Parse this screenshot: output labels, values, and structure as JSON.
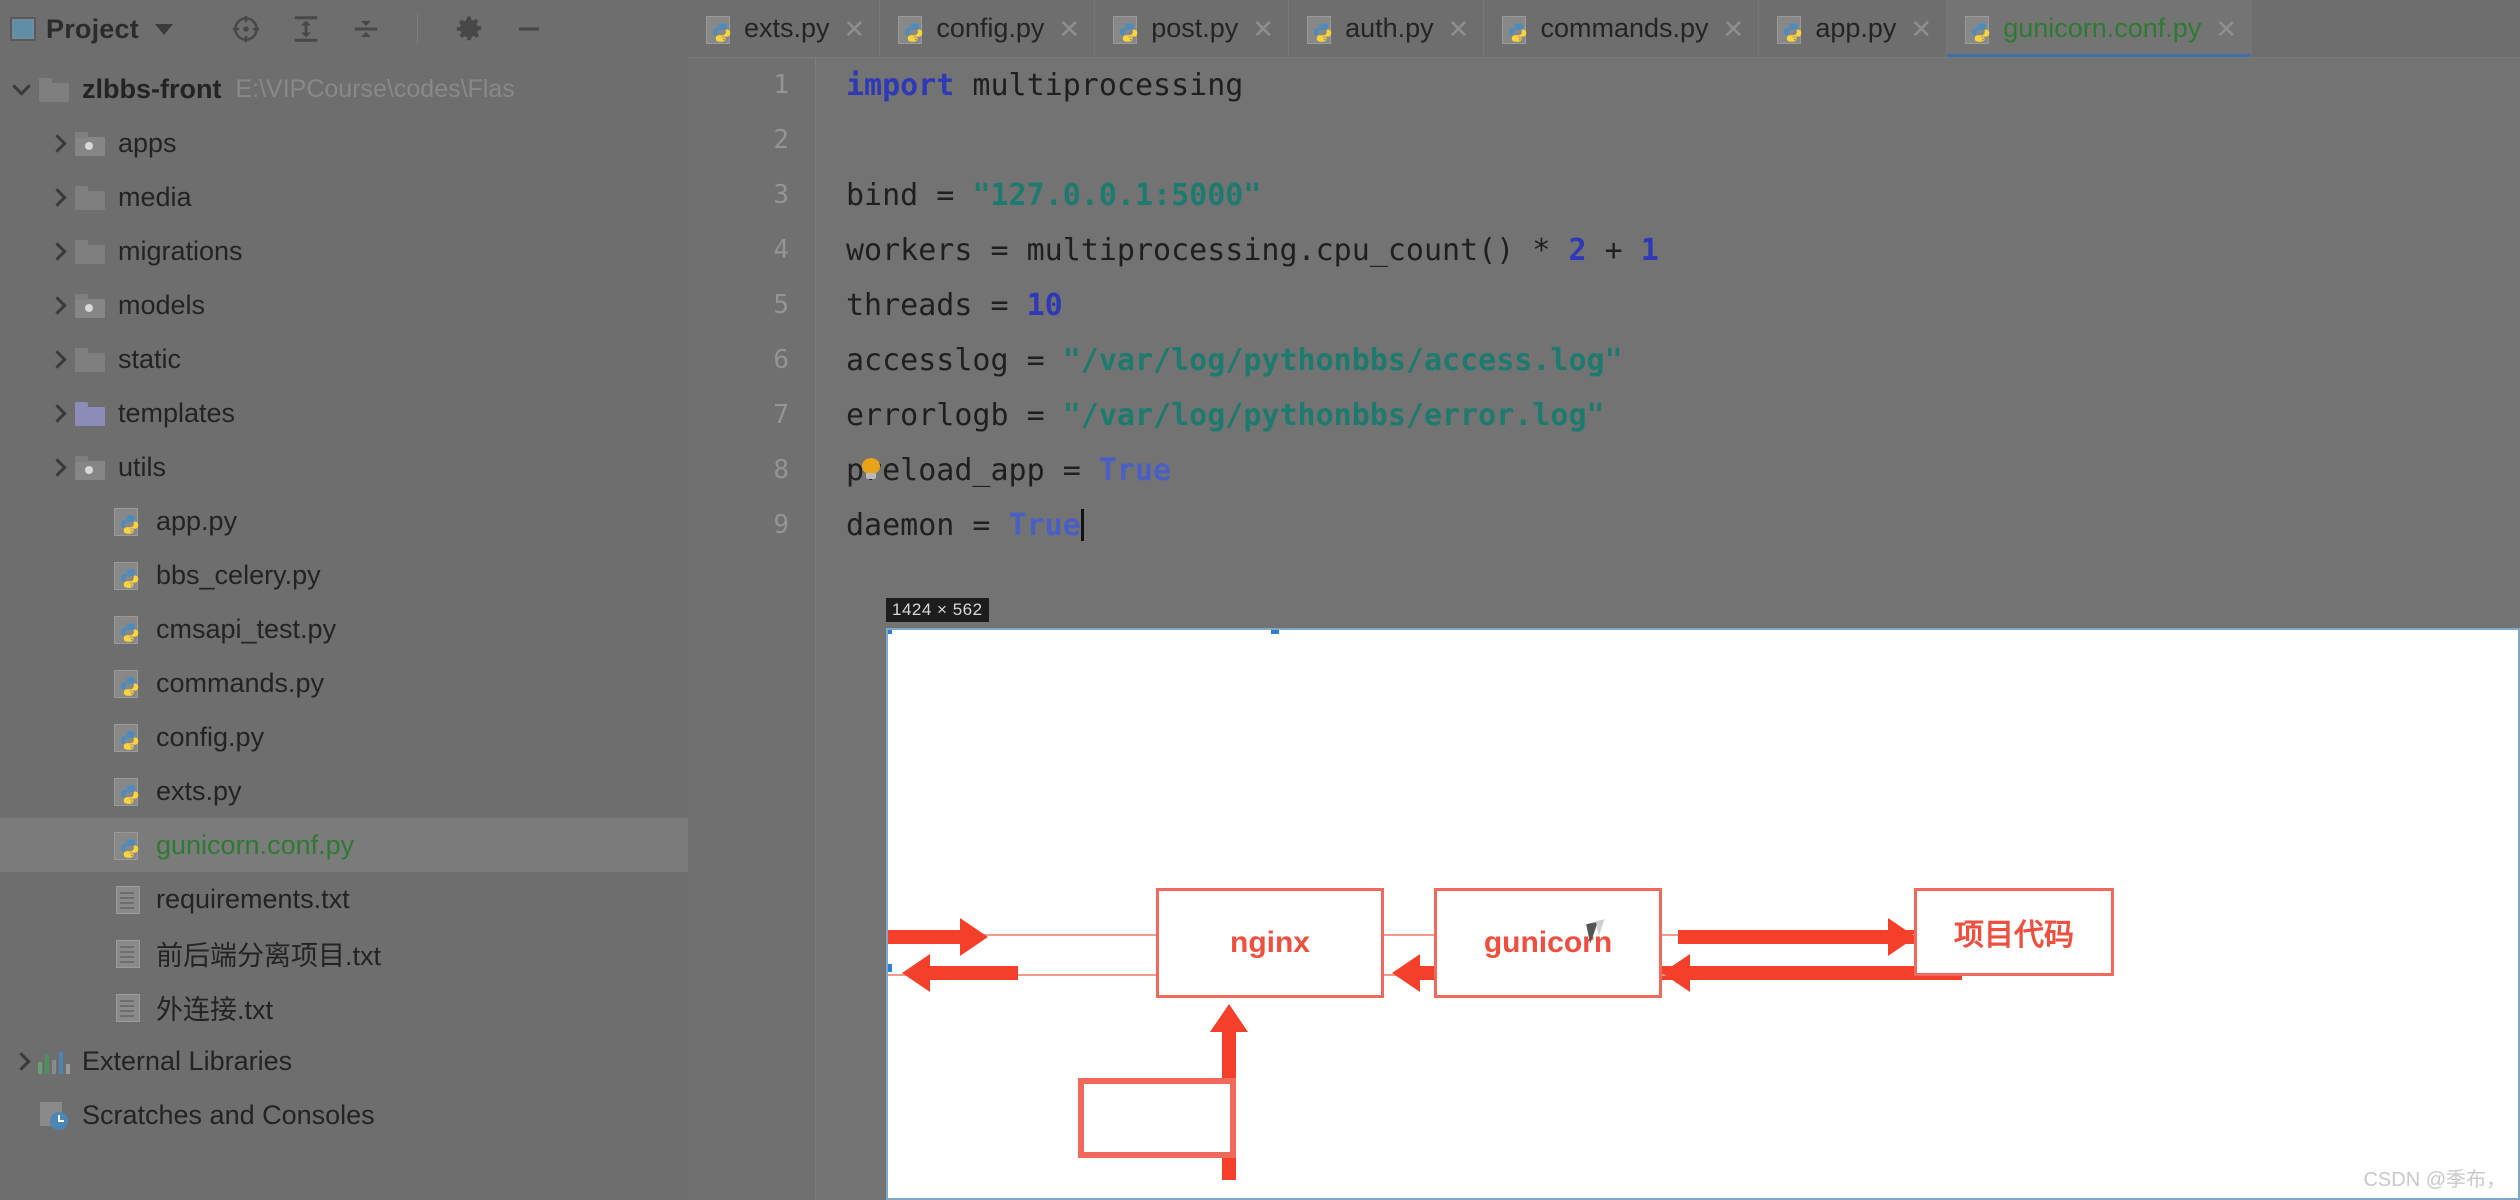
{
  "window": {
    "dim_overlay": true
  },
  "project_panel": {
    "title": "Project",
    "icon": "project-window-icon",
    "dropdown_icon": "chevron-down-icon",
    "toolbar": [
      {
        "name": "select-opened-file-icon",
        "label": "Select Opened File"
      },
      {
        "name": "expand-all-icon",
        "label": "Expand All"
      },
      {
        "name": "collapse-all-icon",
        "label": "Collapse All"
      },
      {
        "name": "gear-icon",
        "label": "Settings"
      },
      {
        "name": "hide-icon",
        "label": "Hide"
      }
    ],
    "tree": [
      {
        "label": "zlbbs-front",
        "path": "E:\\VIPCourse\\codes\\Flas",
        "icon": "folder",
        "arrow": "down",
        "indent": 0,
        "bold": true,
        "selected": false,
        "color": "default"
      },
      {
        "label": "apps",
        "path": "",
        "icon": "folder-src",
        "arrow": "right",
        "indent": 1,
        "bold": false,
        "selected": false,
        "color": "default"
      },
      {
        "label": "media",
        "path": "",
        "icon": "folder",
        "arrow": "right",
        "indent": 1,
        "bold": false,
        "selected": false,
        "color": "default"
      },
      {
        "label": "migrations",
        "path": "",
        "icon": "folder",
        "arrow": "right",
        "indent": 1,
        "bold": false,
        "selected": false,
        "color": "default"
      },
      {
        "label": "models",
        "path": "",
        "icon": "folder-src",
        "arrow": "right",
        "indent": 1,
        "bold": false,
        "selected": false,
        "color": "default"
      },
      {
        "label": "static",
        "path": "",
        "icon": "folder",
        "arrow": "right",
        "indent": 1,
        "bold": false,
        "selected": false,
        "color": "default"
      },
      {
        "label": "templates",
        "path": "",
        "icon": "folder-tpl",
        "arrow": "right",
        "indent": 1,
        "bold": false,
        "selected": false,
        "color": "default"
      },
      {
        "label": "utils",
        "path": "",
        "icon": "folder-src",
        "arrow": "right",
        "indent": 1,
        "bold": false,
        "selected": false,
        "color": "default"
      },
      {
        "label": "app.py",
        "path": "",
        "icon": "python",
        "arrow": "none",
        "indent": 2,
        "bold": false,
        "selected": false,
        "color": "default"
      },
      {
        "label": "bbs_celery.py",
        "path": "",
        "icon": "python",
        "arrow": "none",
        "indent": 2,
        "bold": false,
        "selected": false,
        "color": "default"
      },
      {
        "label": "cmsapi_test.py",
        "path": "",
        "icon": "python",
        "arrow": "none",
        "indent": 2,
        "bold": false,
        "selected": false,
        "color": "default"
      },
      {
        "label": "commands.py",
        "path": "",
        "icon": "python",
        "arrow": "none",
        "indent": 2,
        "bold": false,
        "selected": false,
        "color": "default"
      },
      {
        "label": "config.py",
        "path": "",
        "icon": "python",
        "arrow": "none",
        "indent": 2,
        "bold": false,
        "selected": false,
        "color": "default"
      },
      {
        "label": "exts.py",
        "path": "",
        "icon": "python",
        "arrow": "none",
        "indent": 2,
        "bold": false,
        "selected": false,
        "color": "default"
      },
      {
        "label": "gunicorn.conf.py",
        "path": "",
        "icon": "python",
        "arrow": "none",
        "indent": 2,
        "bold": false,
        "selected": true,
        "color": "green"
      },
      {
        "label": "requirements.txt",
        "path": "",
        "icon": "text",
        "arrow": "none",
        "indent": 2,
        "bold": false,
        "selected": false,
        "color": "default"
      },
      {
        "label": "前后端分离项目.txt",
        "path": "",
        "icon": "text",
        "arrow": "none",
        "indent": 2,
        "bold": false,
        "selected": false,
        "color": "default"
      },
      {
        "label": "外连接.txt",
        "path": "",
        "icon": "text",
        "arrow": "none",
        "indent": 2,
        "bold": false,
        "selected": false,
        "color": "default"
      },
      {
        "label": "External Libraries",
        "path": "",
        "icon": "libraries",
        "arrow": "right",
        "indent": 0,
        "bold": false,
        "selected": false,
        "color": "default"
      },
      {
        "label": "Scratches and Consoles",
        "path": "",
        "icon": "scratches",
        "arrow": "none",
        "indent": 0,
        "bold": false,
        "selected": false,
        "color": "default"
      }
    ]
  },
  "tabs": [
    {
      "label": "exts.py",
      "active": false,
      "close_icon": "close-icon"
    },
    {
      "label": "config.py",
      "active": false,
      "close_icon": "close-icon"
    },
    {
      "label": "post.py",
      "active": false,
      "close_icon": "close-icon"
    },
    {
      "label": "auth.py",
      "active": false,
      "close_icon": "close-icon"
    },
    {
      "label": "commands.py",
      "active": false,
      "close_icon": "close-icon"
    },
    {
      "label": "app.py",
      "active": false,
      "close_icon": "close-icon"
    },
    {
      "label": "gunicorn.conf.py",
      "active": true,
      "close_icon": "close-icon"
    }
  ],
  "editor": {
    "filename": "gunicorn.conf.py",
    "line_numbers": [
      "1",
      "2",
      "3",
      "4",
      "5",
      "6",
      "7",
      "8",
      "9"
    ],
    "lines": [
      {
        "n": "1",
        "tokens": [
          {
            "t": "import",
            "c": "kw"
          },
          {
            "t": " multiprocessing",
            "c": "op"
          }
        ]
      },
      {
        "n": "2",
        "tokens": []
      },
      {
        "n": "3",
        "tokens": [
          {
            "t": "bind = ",
            "c": "op"
          },
          {
            "t": "\"127.0.0.1:5000\"",
            "c": "str"
          }
        ]
      },
      {
        "n": "4",
        "tokens": [
          {
            "t": "workers = multiprocessing.cpu_count() ",
            "c": "op"
          },
          {
            "t": "*",
            "c": "op"
          },
          {
            "t": " ",
            "c": "op"
          },
          {
            "t": "2",
            "c": "num"
          },
          {
            "t": " + ",
            "c": "op"
          },
          {
            "t": "1",
            "c": "num"
          }
        ]
      },
      {
        "n": "5",
        "tokens": [
          {
            "t": "threads = ",
            "c": "op"
          },
          {
            "t": "10",
            "c": "num"
          }
        ]
      },
      {
        "n": "6",
        "tokens": [
          {
            "t": "accesslog = ",
            "c": "op"
          },
          {
            "t": "\"/var/log/pythonbbs/access.log\"",
            "c": "str"
          }
        ]
      },
      {
        "n": "7",
        "tokens": [
          {
            "t": "errorlogb = ",
            "c": "op"
          },
          {
            "t": "\"/var/log/pythonbbs/error.log\"",
            "c": "str"
          }
        ]
      },
      {
        "n": "8",
        "tokens": [
          {
            "t": "preload_app = ",
            "c": "op"
          },
          {
            "t": "True",
            "c": "bool"
          }
        ],
        "intention_bulb": true
      },
      {
        "n": "9",
        "tokens": [
          {
            "t": "daemon = ",
            "c": "op"
          },
          {
            "t": "True",
            "c": "bool"
          }
        ],
        "caret": true
      }
    ],
    "plain_text": "import multiprocessing\n\nbind = \"127.0.0.1:5000\"\nworkers = multiprocessing.cpu_count() * 2 + 1\nthreads = 10\naccesslog = \"/var/log/pythonbbs/access.log\"\nerrorlogb = \"/var/log/pythonbbs/error.log\"\npreload_app = True\ndaemon = True"
  },
  "pasted_image": {
    "dimension_badge": "1424 × 562",
    "selected": true,
    "handle_color": "#2f7fd1",
    "border_color": "#7fa8c9",
    "diagram": {
      "accent_color": "#f4402b",
      "box_border_color": "#ef6a5c",
      "boxes": [
        {
          "name": "nginx-box",
          "label": "nginx"
        },
        {
          "name": "gunicorn-box",
          "label": "gunicorn"
        },
        {
          "name": "project-code-box",
          "label": "项目代码"
        },
        {
          "name": "empty-box",
          "label": ""
        }
      ]
    }
  },
  "watermark": "CSDN @季布，"
}
